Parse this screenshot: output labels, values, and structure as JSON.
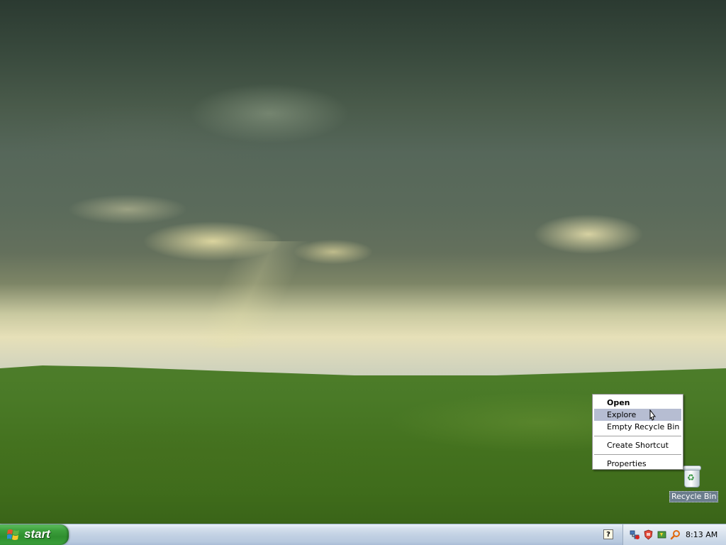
{
  "desktop": {
    "icons": [
      {
        "label": "Recycle Bin"
      }
    ]
  },
  "context_menu": {
    "items": [
      {
        "label": "Open",
        "bold": true
      },
      {
        "label": "Explore",
        "highlighted": true
      },
      {
        "label": "Empty Recycle Bin"
      },
      {
        "separator": true
      },
      {
        "label": "Create Shortcut"
      },
      {
        "separator": true
      },
      {
        "label": "Properties"
      }
    ]
  },
  "taskbar": {
    "start_label": "start",
    "tray": {
      "icons": [
        "network-icon",
        "security-alert-icon",
        "ups-icon",
        "search-icon"
      ],
      "clock": "8:13 AM"
    },
    "quick_help_glyph": "?"
  },
  "colors": {
    "menu_highlight": "#b6bdd2",
    "start_green": "#3c9f3c",
    "taskbar_silver": "#c3d2e4"
  }
}
